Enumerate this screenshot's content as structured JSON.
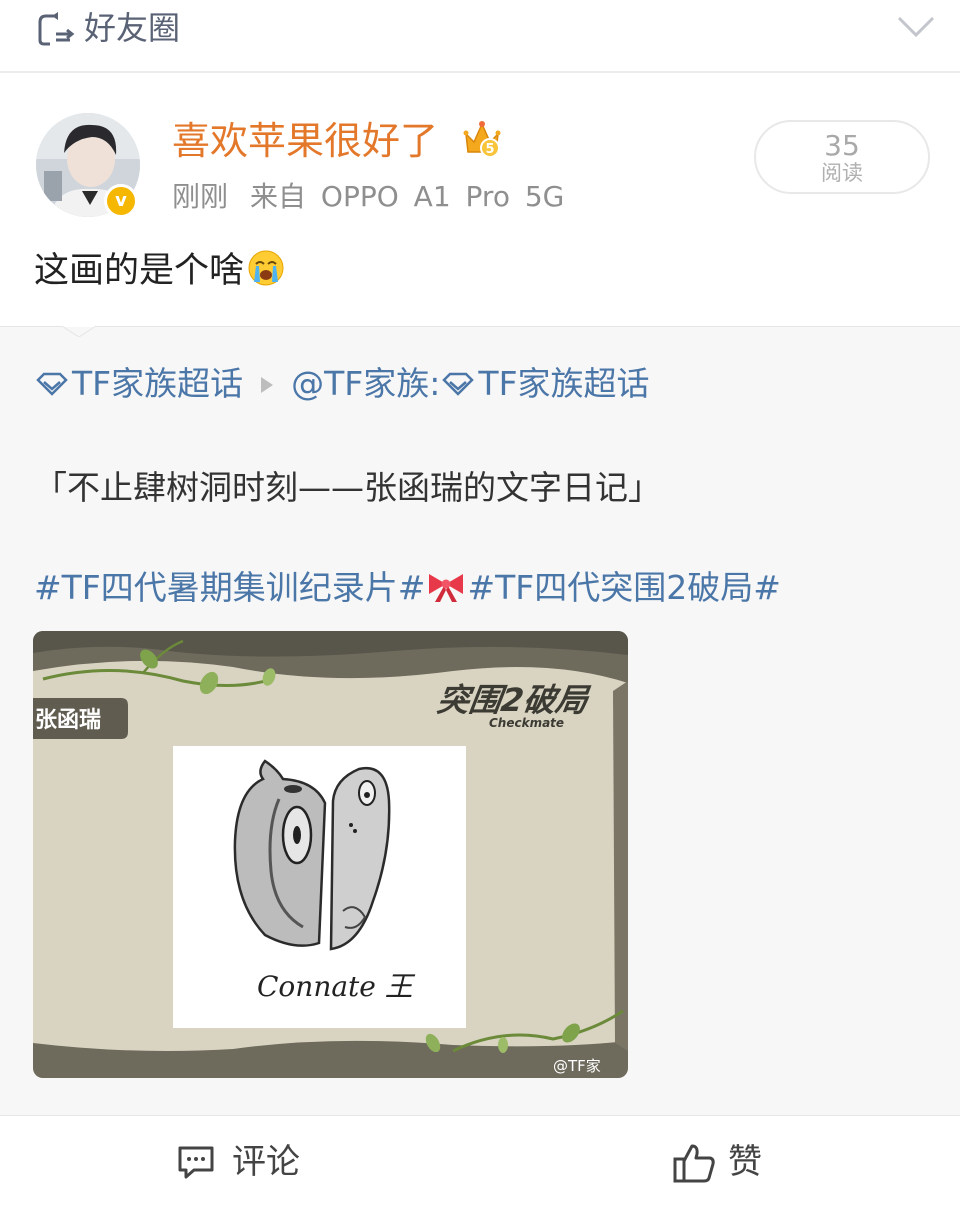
{
  "topbar": {
    "icon": "circle-arrows-icon",
    "title": "好友圈",
    "collapse_icon": "chevron-down-icon"
  },
  "post": {
    "username": "喜欢苹果很好了",
    "member_badge_icon": "crown-vip-icon",
    "verified_badge": "v",
    "time": "刚刚",
    "source": "来自 OPPO A1 Pro 5G",
    "read_count": "35",
    "read_label": "阅读",
    "text": "这画的是个啥",
    "text_emoji": "crying-emoji-icon"
  },
  "repost": {
    "supertopic": "TF家族超话",
    "author": "@TF家族",
    "colon": ":",
    "supertopic2": "TF家族超话",
    "quote": "「不止肆树洞时刻——张函瑞的文字日记」",
    "tag1": "#TF四代暑期集训纪录片#",
    "tag_emoji": "bow-emoji-icon",
    "tag2": "#TF四代突围2破局#",
    "image": {
      "name_tag": "张函瑞",
      "logo_main": "突围2破局",
      "logo_sub": "Checkmate",
      "signature": "Connate 王",
      "watermark": "@TF家"
    }
  },
  "actions": {
    "comment_label": "评论",
    "like_label": "赞"
  },
  "colors": {
    "username": "#e3782b",
    "link": "#4b76a8",
    "repost_bg": "#f7f7f7",
    "verified": "#f5b700"
  }
}
